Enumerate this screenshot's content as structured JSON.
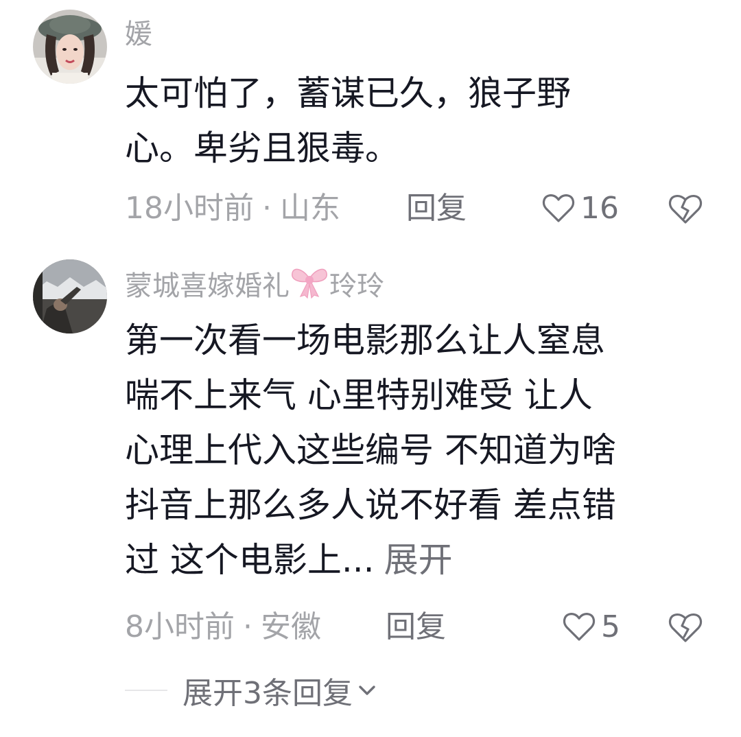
{
  "comments": [
    {
      "username": "媛",
      "content_lines": [
        "太可怕了，蓄谋已久，狼子野",
        "心。卑劣且狠毒。"
      ],
      "expand_label": "",
      "time": "18小时前",
      "separator": "·",
      "location": "山东",
      "reply_label": "回复",
      "likes": "16"
    },
    {
      "username": "蒙城喜嫁婚礼",
      "username_suffix": "玲玲",
      "content_lines": [
        "第一次看一场电影那么让人窒息",
        "喘不上来气  心里特别难受  让人",
        "心理上代入这些编号  不知道为啥",
        "抖音上那么多人说不好看 差点错",
        "过  这个电影上..."
      ],
      "expand_label": "展开",
      "time": "8小时前",
      "separator": "·",
      "location": "安徽",
      "reply_label": "回复",
      "likes": "5",
      "replies_toggle": "展开3条回复"
    }
  ],
  "icons": {
    "like": "heart-outline-icon",
    "dislike": "broken-heart-icon",
    "bow": "pink-bow-emoji-icon",
    "chevron": "chevron-down-icon"
  },
  "colors": {
    "text": "#161823",
    "meta": "#a3a4a8",
    "action": "#6f7077",
    "background": "#ffffff"
  }
}
